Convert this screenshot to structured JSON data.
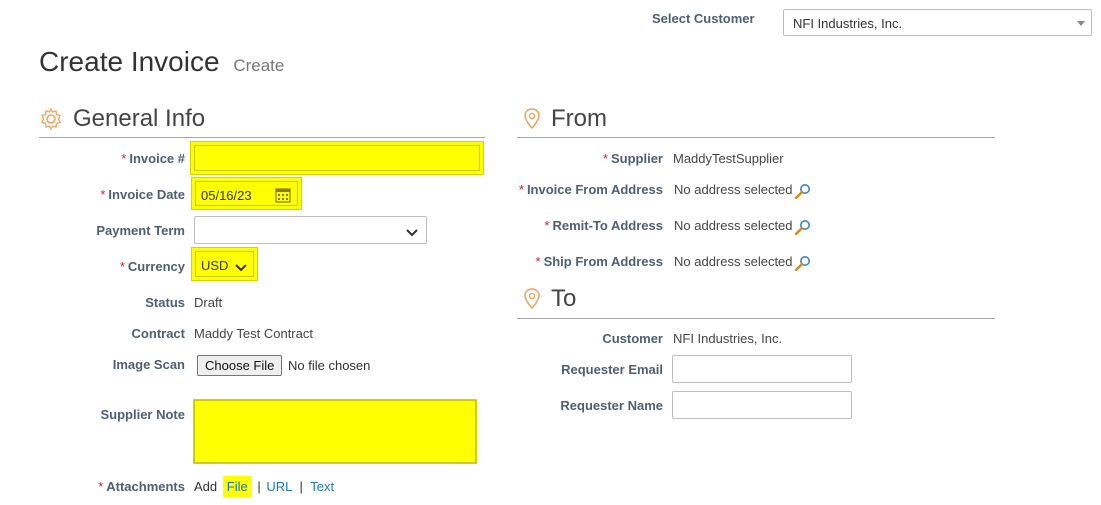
{
  "header": {
    "select_customer_label": "Select Customer",
    "customer_value": "NFI Industries, Inc.",
    "page_title": "Create Invoice",
    "page_subtitle": "Create"
  },
  "general": {
    "section_title": "General Info",
    "invoice_no_label": "Invoice #",
    "invoice_no_value": "",
    "invoice_date_label": "Invoice Date",
    "invoice_date_value": "05/16/23",
    "payment_term_label": "Payment Term",
    "payment_term_value": "",
    "currency_label": "Currency",
    "currency_value": "USD",
    "status_label": "Status",
    "status_value": "Draft",
    "contract_label": "Contract",
    "contract_value": "Maddy Test Contract",
    "image_scan_label": "Image Scan",
    "choose_file_label": "Choose File",
    "no_file_text": "No file chosen",
    "supplier_note_label": "Supplier Note",
    "supplier_note_value": "",
    "attachments_label": "Attachments",
    "add_text": "Add",
    "file_link": "File",
    "url_link": "URL",
    "text_link": "Text",
    "separator": "|"
  },
  "from": {
    "section_title": "From",
    "supplier_label": "Supplier",
    "supplier_value": "MaddyTestSupplier",
    "invoice_from_label": "Invoice From Address",
    "remit_to_label": "Remit-To Address",
    "ship_from_label": "Ship From Address",
    "no_address_text": "No address selected"
  },
  "to": {
    "section_title": "To",
    "customer_label": "Customer",
    "customer_value": "NFI Industries, Inc.",
    "requester_email_label": "Requester Email",
    "requester_email_value": "",
    "requester_name_label": "Requester Name",
    "requester_name_value": ""
  },
  "required_marker": "*",
  "colors": {
    "highlight": "#ffff00",
    "required": "#d0202a",
    "label": "#4f5f73",
    "link": "#1a78c2",
    "section_icon": "#f0a25a"
  },
  "icons": {
    "general": "gear-icon",
    "from": "location-pin-icon",
    "to": "location-pin-icon",
    "calendar": "calendar-icon",
    "address_lookup": "magnifier-icon"
  }
}
